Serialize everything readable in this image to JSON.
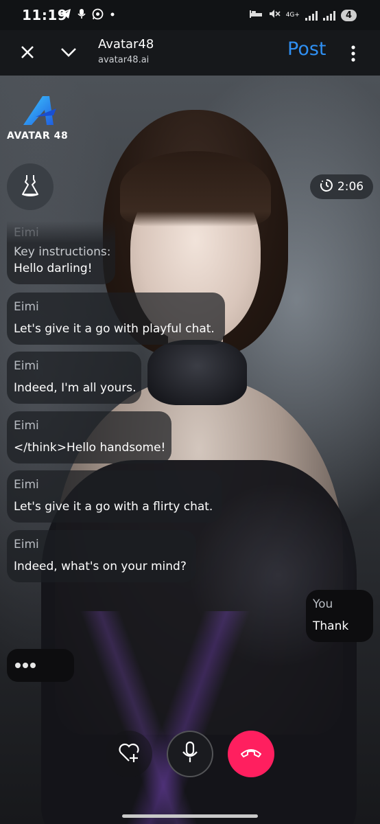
{
  "status_bar": {
    "time": "11:19",
    "battery": "4",
    "network": "4G+",
    "left_icons": [
      "telegram-icon",
      "mic-icon",
      "whatsapp-icon",
      "dot"
    ],
    "right_icons": [
      "bed-icon",
      "mute-icon",
      "4g-icon",
      "signal-icon",
      "signal-icon",
      "battery-icon"
    ]
  },
  "app_bar": {
    "title": "Avatar48",
    "url": "avatar48.ai",
    "post_label": "Post"
  },
  "logo": {
    "text": "AVATAR 48"
  },
  "timer": {
    "value": "2:06"
  },
  "messages": [
    {
      "sender": "Eimi",
      "text": "Key instructions:\nHello darling!"
    },
    {
      "sender": "Eimi",
      "text": "Let's give it a go with playful chat."
    },
    {
      "sender": "Eimi",
      "text": "Indeed, I'm all yours."
    },
    {
      "sender": "Eimi",
      "text": "</think>Hello handsome!"
    },
    {
      "sender": "Eimi",
      "text": "Let's give it a go with a flirty chat."
    },
    {
      "sender": "Eimi",
      "text": "Indeed, what's on your mind?"
    }
  ],
  "first_message": {
    "line1": "Key instructions:",
    "line2": "Hello darling!"
  },
  "user_message": {
    "sender": "You",
    "text": "Thank"
  },
  "colors": {
    "accent": "#2f8ff2",
    "end_call": "#ff1f5f"
  }
}
